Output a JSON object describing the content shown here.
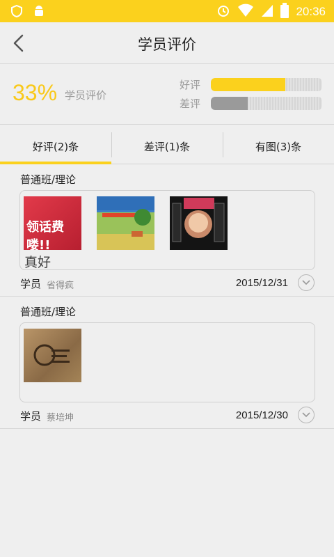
{
  "status_bar": {
    "time": "20:36",
    "icons": [
      "shield-icon",
      "android-icon",
      "alarm-icon",
      "wifi-icon",
      "signal-icon",
      "battery-icon"
    ],
    "color": "#fbd11d"
  },
  "header": {
    "title": "学员评价",
    "back_icon": "chevron-left-icon"
  },
  "summary": {
    "percent": "33%",
    "label": "学员评价",
    "good_label": "好评",
    "bad_label": "差评",
    "good_ratio": 0.67,
    "bad_ratio": 0.33,
    "accent": "#fbd11d"
  },
  "tabs": [
    {
      "label": "好评(2)条",
      "active": true
    },
    {
      "label": "差评(1)条",
      "active": false
    },
    {
      "label": "有图(3)条",
      "active": false
    }
  ],
  "reviews": [
    {
      "course": "普通班/理论",
      "comment": "真好",
      "photo_texts": [
        "领话费喽!!"
      ],
      "role": "学员",
      "name": "省得疯",
      "date": "2015/12/31"
    },
    {
      "course": "普通班/理论",
      "comment": "",
      "role": "学员",
      "name": "蔡培坤",
      "date": "2015/12/30"
    }
  ]
}
